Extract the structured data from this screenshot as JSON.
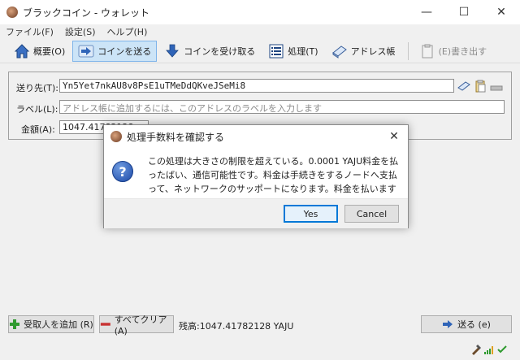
{
  "window": {
    "title": "ブラックコイン - ウォレット",
    "controls": {
      "minimize": "—",
      "maximize": "☐",
      "close": "✕"
    }
  },
  "menu": [
    "ファイル(F)",
    "設定(S)",
    "ヘルプ(H)"
  ],
  "toolbar": {
    "overview": "概要(O)",
    "send": "コインを送る",
    "receive": "コインを受け取る",
    "transactions": "処理(T)",
    "address_book": "アドレス帳",
    "export": "(E)書き出す"
  },
  "form": {
    "pay_to_label": "送り先(T):",
    "pay_to_value": "Yn5Yet7nkAU8v8PsE1uTMeDdQKveJSeMi8",
    "label_label": "ラベル(L):",
    "label_placeholder": "アドレス帳に追加するには、このアドレスのラベルを入力します",
    "amount_label": "金額(A):",
    "amount_value": "1047.41782128"
  },
  "bottom": {
    "add_recipient": "受取人を追加 (R)",
    "clear_all": "すべてクリア (A)",
    "balance": "残高:1047.41782128 YAJU",
    "send": "送る (e)"
  },
  "dialog": {
    "title": "処理手数料を確認する",
    "message": "この処理は大きさの制限を超えている。0.0001 YAJU料金を払ったばい、通信可能性です。料金は手続きをするノードへ支払って、ネットワークのサッポートになります。料金を払いますか。",
    "yes": "Yes",
    "cancel": "Cancel",
    "close": "✕"
  },
  "icons": {
    "question": "?"
  },
  "colors": {
    "active_tab": "#cce4f7",
    "default_button_border": "#0078d7",
    "question_icon": "#1c4aa8"
  }
}
